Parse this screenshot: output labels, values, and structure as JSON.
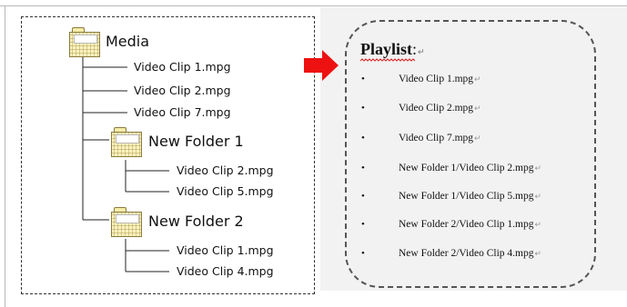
{
  "tree": {
    "root": {
      "label": "Media",
      "icon": "folder-icon"
    },
    "root_files": [
      "Video Clip 1.mpg",
      "Video Clip 2.mpg",
      "Video Clip 7.mpg"
    ],
    "subfolders": [
      {
        "label": "New Folder 1",
        "icon": "folder-icon",
        "files": [
          "Video Clip 2.mpg",
          "Video Clip 5.mpg"
        ]
      },
      {
        "label": "New Folder 2",
        "icon": "folder-icon",
        "files": [
          "Video Clip 1.mpg",
          "Video Clip 4.mpg"
        ]
      }
    ]
  },
  "arrow": {
    "color": "#ee1111",
    "icon": "right-arrow-icon"
  },
  "playlist": {
    "title": "Playlist",
    "colon": ":",
    "paragraph_mark": "↵",
    "bullet": "•",
    "items": [
      "Video Clip 1.mpg",
      "Video Clip 2.mpg",
      "Video Clip 7.mpg",
      "New Folder 1/Video Clip 2.mpg",
      "New Folder 1/Video Clip 5.mpg",
      "New Folder 2/Video Clip 1.mpg",
      "New Folder 2/Video Clip 4.mpg"
    ]
  }
}
